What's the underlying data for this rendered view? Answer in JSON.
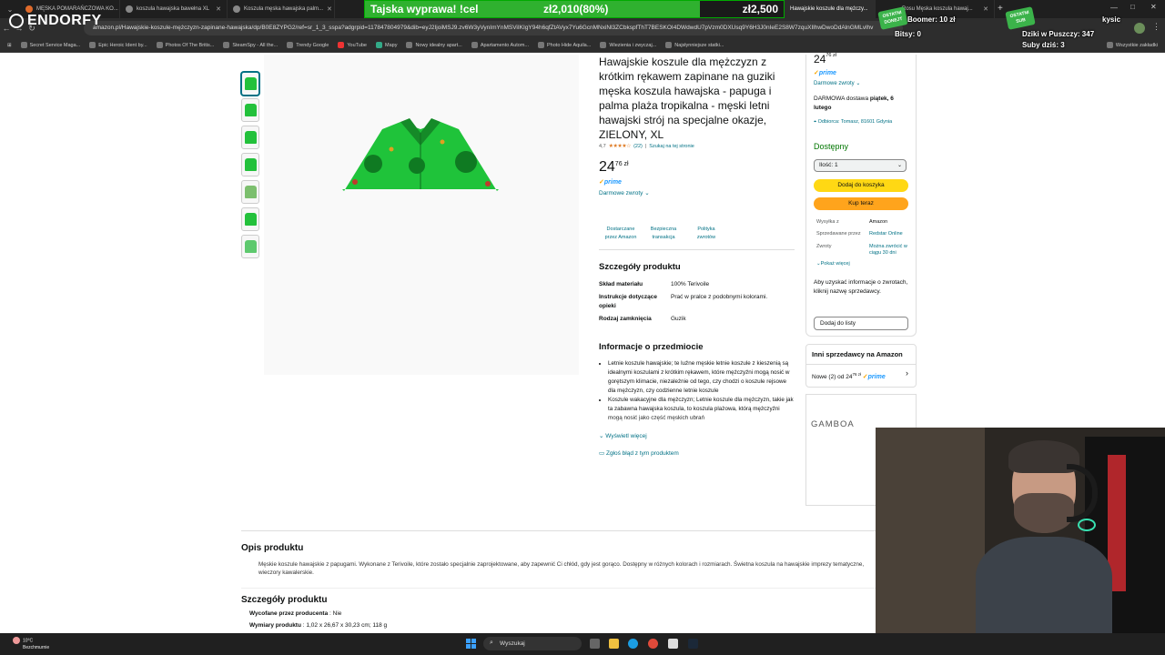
{
  "tabs": [
    {
      "label": "MĘSKA POMARAŃCZOWA KO...",
      "active": false
    },
    {
      "label": "koszula hawajska bawełna XL",
      "active": false
    },
    {
      "label": "Koszula męska hawajska palm...",
      "active": false
    },
    {
      "label": "Hawajskie koszule dla mężczy...",
      "active": true
    },
    {
      "label": "Rosu Męska koszula hawaj...",
      "active": false
    }
  ],
  "address": {
    "url": "amazon.pl/Hawajskie-koszule-mężczyzn-zapinane-hawajska/dp/B0E8ZYPG2/ref=sr_1_3_sspa?adgrpid=117847804979&dib=eyJ2IjoiMSJ9.zv6W3yVynImYnMSViIKIgY94h6qfZtAVyx7Yu6GcnMNxiNl3ZCbkspfThT7BESKOI4DWdwdU7pVzm0DXUsq9Y6H3J0nIeE2S8W7zquXIlhwDwoDdAlnGMLvlhv"
  },
  "bookmarks": [
    "Secret Service Maga...",
    "Epic Heroic Ident by...",
    "Photos Of The Britis...",
    "SteamSpy - All the...",
    "Trendy Google",
    "YouTube",
    "Mapy",
    "Nowy idealny apart...",
    "Apartamento Autom...",
    "Photo Hide Aquila...",
    "Wiezienia i zwyczaj...",
    "Najsłynniejsze statki..."
  ],
  "bookmarks_right": "Wszystkie zakładki",
  "overlay": {
    "brand": "ENDORFY",
    "goal_title": "Tajska wyprawa! !cel",
    "goal_current": "zł2,010(80%)",
    "goal_target": "zł2,500",
    "goal_progress": 0.8,
    "badge1": "OSTATNI DONEJT",
    "badge2": "OSTATNI SUB",
    "last_donation": "Boomer: 10 zł",
    "bits": "Bitsy: 0",
    "last_sub": "kysic",
    "dziki": "Dziki w Puszczy: 347",
    "subs_today": "Suby dziś: 3"
  },
  "product": {
    "title": "Hawajskie koszule dla mężczyzn z krótkim rękawem zapinane na guziki męska koszula hawajska - papuga i palma plaża tropikalna - męski letni hawajski strój na specjalne okazje, ZIELONY, XL",
    "rating": "4,7",
    "stars": "★★★★☆",
    "reviews": "(22)",
    "search_page": "Szukaj na tej stronie",
    "price_whole": "24",
    "price_fraction": "76 zł",
    "prime": "prime",
    "free_returns": "Darmowe zwroty",
    "features": [
      {
        "line1": "Dostarczane",
        "line2": "przez Amazon"
      },
      {
        "line1": "Bezpieczna",
        "line2": "transakcja"
      },
      {
        "line1": "Polityka",
        "line2": "zwrotów"
      }
    ],
    "details_title": "Szczegóły produktu",
    "details": [
      {
        "k": "Skład materiału",
        "v": "100% Terivoile"
      },
      {
        "k": "Instrukcje dotyczące opieki",
        "v": "Prać w pralce z podobnymi kolorami."
      },
      {
        "k": "Rodzaj zamknięcia",
        "v": "Guzik"
      }
    ],
    "about_title": "Informacje o przedmiocie",
    "bullets": [
      "Letnie koszule hawajskie; te luźne męskie letnie koszule z kieszenią są idealnymi koszulami z krótkim rękawem, które mężczyźni mogą nosić w gorętszym klimacie, niezależnie od tego, czy chodzi o koszule rejsowe dla mężczyzn, czy codzienne letnie koszule",
      "Koszule wakacyjne dla mężczyzn; Letnie koszule dla mężczyzn, takie jak ta zabawna hawajska koszula, to koszula plażowa, którą mężczyźni mogą nosić jako część męskich ubrań"
    ],
    "show_more": "Wyświetl więcej",
    "report": "Zgłoś błąd z tym produktem"
  },
  "buybox": {
    "price_whole": "24",
    "price_fraction": "76 zł",
    "prime": "prime",
    "free_returns": "Darmowe zwroty",
    "delivery_prefix": "DARMOWA dostawa ",
    "delivery_date": "piątek, 6 lutego",
    "location": "Odbiorca: Tomasz, 81601 Gdynia",
    "in_stock": "Dostępny",
    "qty": "Ilość: 1",
    "add_to_cart": "Dodaj do koszyka",
    "buy_now": "Kup teraz",
    "ships_from_k": "Wysyłka z",
    "ships_from_v": "Amazon",
    "sold_by_k": "Sprzedawane przez",
    "sold_by_v": "Redstar Online",
    "returns_k": "Zwroty",
    "returns_v": "Można zwrócić w ciągu 30 dni",
    "show_more": "Pokaż więcej",
    "return_info": "Aby uzyskać informacje o zwrotach, kliknij nazwę sprzedawcy.",
    "add_list": "Dodaj do listy"
  },
  "other_sellers": {
    "title": "Inni sprzedawcy na Amazon",
    "new_from": "Nowe (2) od 24",
    "new_from_sup": "76 zł",
    "prime": "prime"
  },
  "ad": {
    "brand": "GAMBOA"
  },
  "description": {
    "title": "Opis produktu",
    "text": "Męskie koszule hawajskie z papugami. Wykonane z Terivoile, które zostało specjalnie zaprojektowane, aby zapewnić Ci chłód, gdy jest gorąco. Dostępny w różnych kolorach i rozmiarach. Świetna koszula na hawajskie imprezy tematyczne, wieczory kawalerskie."
  },
  "details2": {
    "title": "Szczegóły produktu",
    "rows": [
      {
        "k": "Wycofane przez producenta",
        "v": "Nie"
      },
      {
        "k": "Wymiary produktu",
        "v": "1,02 x 26,67 x 30,23 cm; 118 g"
      }
    ]
  },
  "taskbar": {
    "temp": "10°C",
    "weather": "Bezchmurnie",
    "search": "Wyszukaj"
  },
  "colors": {
    "amazon_link": "#007185",
    "add_to_cart": "#ffd814",
    "buy_now": "#ffa41c",
    "in_stock": "#007600",
    "shirt_green": "#23c13b",
    "goal_green": "#2fb12f"
  }
}
